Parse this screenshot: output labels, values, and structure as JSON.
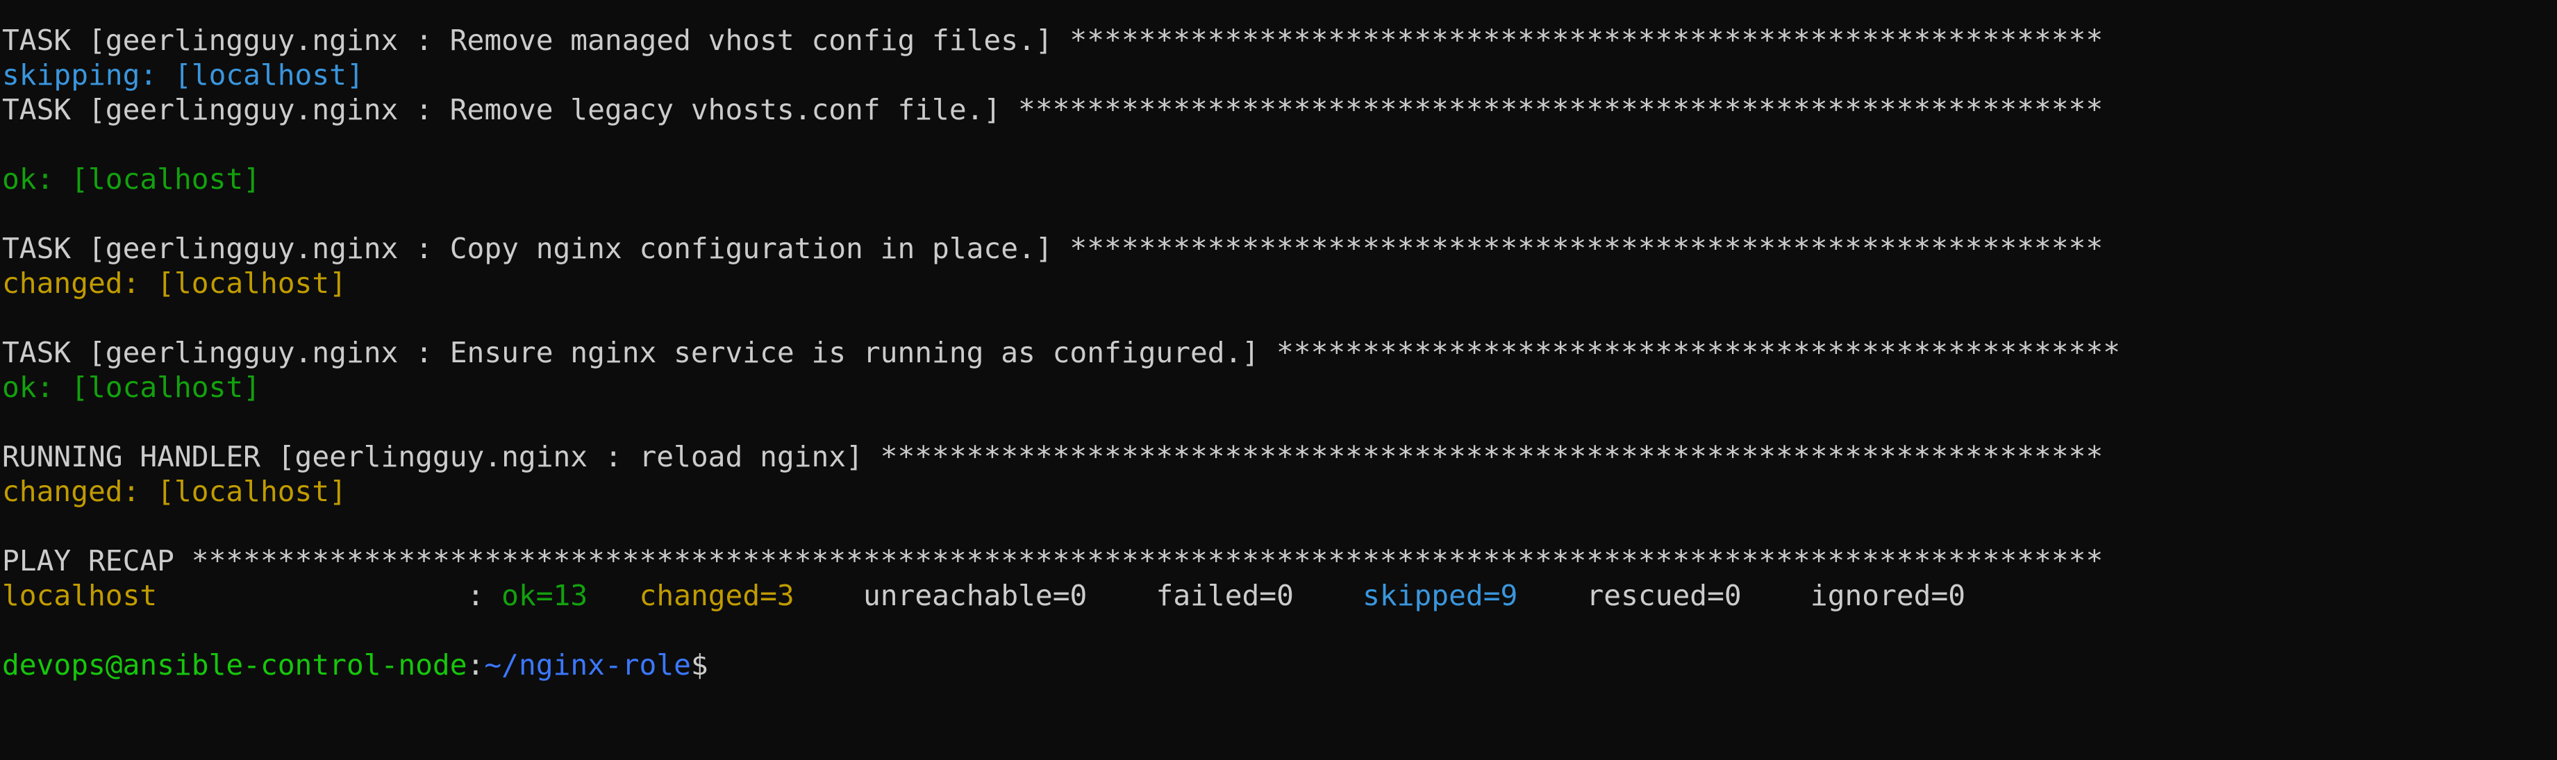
{
  "colors": {
    "background": "#0c0c0c",
    "text": "#cccccc",
    "skipping": "#3a96dd",
    "ok": "#13a10e",
    "changed": "#c19c00",
    "prompt_user": "#16c60c",
    "prompt_path": "#3b78ff"
  },
  "lines": {
    "task1": {
      "text": "TASK [geerlingguy.nginx : Remove managed vhost config files.] ",
      "stars": "************************************************************"
    },
    "skip1": "skipping: [localhost]",
    "task2": {
      "text": "TASK [geerlingguy.nginx : Remove legacy vhosts.conf file.] ",
      "stars": "***************************************************************"
    },
    "ok1": "ok: [localhost]",
    "task3": {
      "text": "TASK [geerlingguy.nginx : Copy nginx configuration in place.] ",
      "stars": "************************************************************"
    },
    "changed1": "changed: [localhost]",
    "task4": {
      "text": "TASK [geerlingguy.nginx : Ensure nginx service is running as configured.] ",
      "stars": "*************************************************"
    },
    "ok2": "ok: [localhost]",
    "handler": {
      "text": "RUNNING HANDLER [geerlingguy.nginx : reload nginx] ",
      "stars": "***********************************************************************"
    },
    "changed2": "changed: [localhost]",
    "recap": {
      "text": "PLAY RECAP ",
      "stars": "***************************************************************************************************************"
    }
  },
  "recap_row": {
    "host": "localhost",
    "separator": "                  : ",
    "ok": "ok=13",
    "changed": "changed=3",
    "unreachable": "unreachable=0",
    "failed": "failed=0",
    "skipped": "skipped=9",
    "rescued": "rescued=0",
    "ignored": "ignored=0"
  },
  "prompt": {
    "user_host": "devops@ansible-control-node",
    "colon": ":",
    "path": "~/nginx-role",
    "symbol": "$"
  }
}
